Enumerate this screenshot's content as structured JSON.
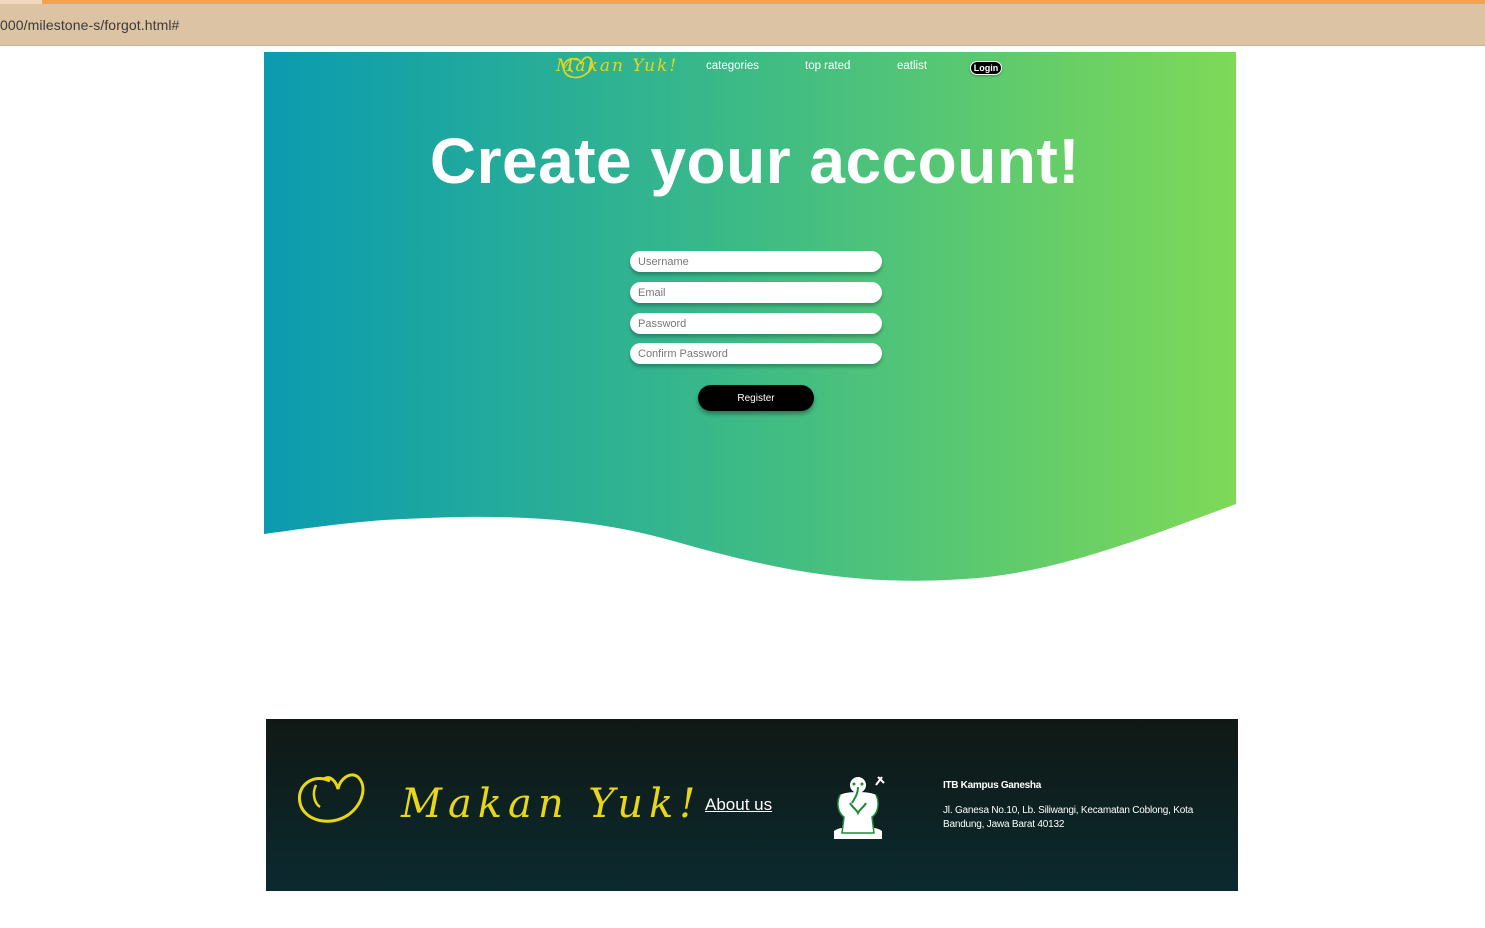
{
  "browser": {
    "url": "000/milestone-s/forgot.html#"
  },
  "colors": {
    "gradient_start": "#0a9bb0",
    "gradient_end": "#7ed957",
    "brand_yellow": "#e8d618",
    "footer_bg": "#0c2327"
  },
  "header": {
    "brand": "Makan Yuk!",
    "nav": [
      "categories",
      "top rated",
      "eatlist"
    ],
    "login_label": "Login"
  },
  "hero": {
    "title": "Create your account!"
  },
  "form": {
    "username_placeholder": "Username",
    "email_placeholder": "Email",
    "password_placeholder": "Password",
    "confirm_placeholder": "Confirm Password",
    "register_label": "Register"
  },
  "footer": {
    "brand": "Makan Yuk!",
    "about_label": "About us",
    "address_title": "ITB Kampus Ganesha",
    "address_text": "Jl. Ganesa No.10, Lb. Siliwangi, Kecamatan Coblong, Kota Bandung, Jawa Barat 40132"
  }
}
